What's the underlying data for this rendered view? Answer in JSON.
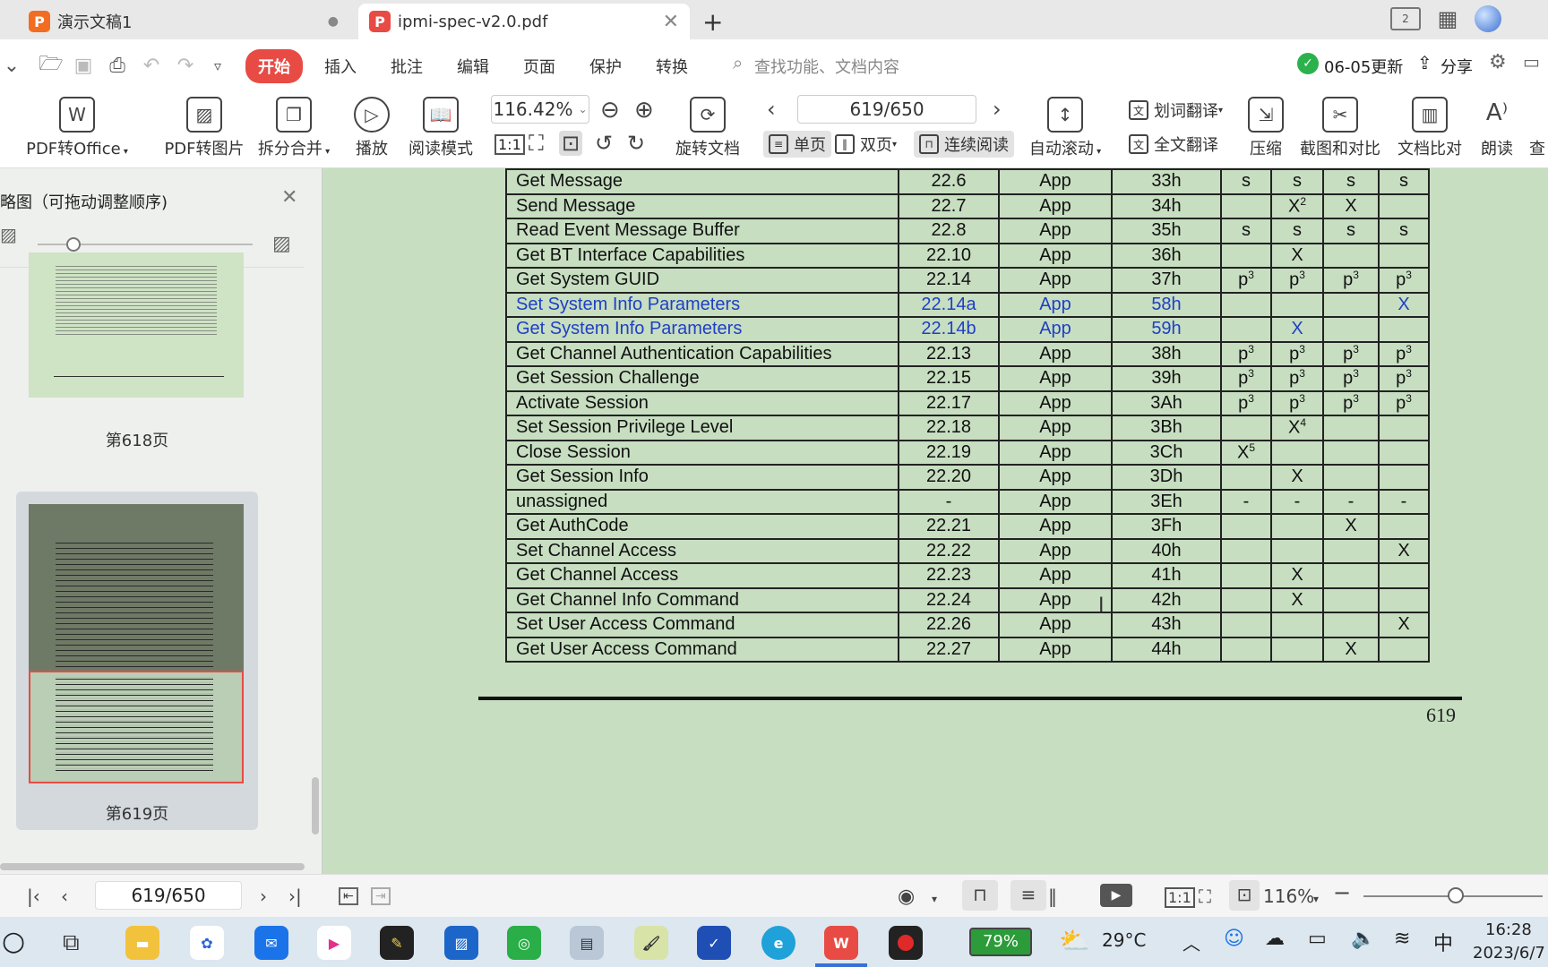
{
  "tabs": [
    {
      "label": "演示文稿1",
      "logo": "P",
      "color": "#f26d21"
    },
    {
      "label": "ipmi-spec-v2.0.pdf",
      "logo": "P",
      "color": "#e84b44"
    }
  ],
  "menu": {
    "items": [
      "开始",
      "插入",
      "批注",
      "编辑",
      "页面",
      "保护",
      "转换"
    ],
    "search_placeholder": "查找功能、文档内容",
    "update": "06-05更新",
    "share": "分享"
  },
  "ribbon": {
    "pdf_to_office": "PDF转Office",
    "pdf_to_image": "PDF转图片",
    "split_merge": "拆分合并",
    "play": "播放",
    "read_mode": "阅读模式",
    "zoom": "116.42%",
    "rotate": "旋转文档",
    "page_field": "619/650",
    "single_page": "单页",
    "double_page": "双页",
    "continuous": "连续阅读",
    "auto_scroll": "自动滚动",
    "word_translate": "划词翻译",
    "full_translate": "全文翻译",
    "compress": "压缩",
    "screenshot_compare": "截图和对比",
    "doc_compare": "文档比对",
    "read_aloud": "朗读",
    "more": "查"
  },
  "sidebar": {
    "title": "略图（可拖动调整顺序)",
    "thumbs": [
      {
        "label": "第618页"
      },
      {
        "label": "第619页"
      }
    ]
  },
  "table": {
    "rows": [
      {
        "name": "Get Message",
        "section": "22.6",
        "netfn": "App",
        "cmd": "33h",
        "c1": "s",
        "c2": "s",
        "c3": "s",
        "c4": "s",
        "link": false
      },
      {
        "name": "Send Message",
        "section": "22.7",
        "netfn": "App",
        "cmd": "34h",
        "c1": "",
        "c2": "X",
        "c2sup": "2",
        "c3": "X",
        "c4": "",
        "link": false
      },
      {
        "name": "Read Event Message Buffer",
        "section": "22.8",
        "netfn": "App",
        "cmd": "35h",
        "c1": "s",
        "c2": "s",
        "c3": "s",
        "c4": "s",
        "link": false
      },
      {
        "name": "Get BT Interface Capabilities",
        "section": "22.10",
        "netfn": "App",
        "cmd": "36h",
        "c1": "",
        "c2": "X",
        "c3": "",
        "c4": "",
        "link": false
      },
      {
        "name": "Get System GUID",
        "section": "22.14",
        "netfn": "App",
        "cmd": "37h",
        "c1": "p",
        "c1sup": "3",
        "c2": "p",
        "c2sup": "3",
        "c3": "p",
        "c3sup": "3",
        "c4": "p",
        "c4sup": "3",
        "link": false
      },
      {
        "name": "Set System Info Parameters",
        "section": "22.14a",
        "netfn": "App",
        "cmd": "58h",
        "c1": "",
        "c2": "",
        "c3": "",
        "c4": "X",
        "link": true
      },
      {
        "name": "Get System Info Parameters",
        "section": "22.14b",
        "netfn": "App",
        "cmd": "59h",
        "c1": "",
        "c2": "X",
        "c3": "",
        "c4": "",
        "link": true
      },
      {
        "name": "Get Channel Authentication Capabilities",
        "section": "22.13",
        "netfn": "App",
        "cmd": "38h",
        "c1": "p",
        "c1sup": "3",
        "c2": "p",
        "c2sup": "3",
        "c3": "p",
        "c3sup": "3",
        "c4": "p",
        "c4sup": "3",
        "link": false
      },
      {
        "name": "Get Session Challenge",
        "section": "22.15",
        "netfn": "App",
        "cmd": "39h",
        "c1": "p",
        "c1sup": "3",
        "c2": "p",
        "c2sup": "3",
        "c3": "p",
        "c3sup": "3",
        "c4": "p",
        "c4sup": "3",
        "link": false
      },
      {
        "name": "Activate Session",
        "section": "22.17",
        "netfn": "App",
        "cmd": "3Ah",
        "c1": "p",
        "c1sup": "3",
        "c2": "p",
        "c2sup": "3",
        "c3": "p",
        "c3sup": "3",
        "c4": "p",
        "c4sup": "3",
        "link": false
      },
      {
        "name": "Set Session Privilege Level",
        "section": "22.18",
        "netfn": "App",
        "cmd": "3Bh",
        "c1": "",
        "c2": "X",
        "c2sup": "4",
        "c3": "",
        "c4": "",
        "link": false
      },
      {
        "name": "Close Session",
        "section": "22.19",
        "netfn": "App",
        "cmd": "3Ch",
        "c1": "X",
        "c1sup": "5",
        "c2": "",
        "c3": "",
        "c4": "",
        "link": false
      },
      {
        "name": "Get Session Info",
        "section": "22.20",
        "netfn": "App",
        "cmd": "3Dh",
        "c1": "",
        "c2": "X",
        "c3": "",
        "c4": "",
        "link": false
      },
      {
        "name": "unassigned",
        "section": "-",
        "netfn": "App",
        "cmd": "3Eh",
        "c1": "-",
        "c2": "-",
        "c3": "-",
        "c4": "-",
        "link": false
      },
      {
        "name": "Get AuthCode",
        "section": "22.21",
        "netfn": "App",
        "cmd": "3Fh",
        "c1": "",
        "c2": "",
        "c3": "X",
        "c4": "",
        "link": false
      },
      {
        "name": "Set Channel Access",
        "section": "22.22",
        "netfn": "App",
        "cmd": "40h",
        "c1": "",
        "c2": "",
        "c3": "",
        "c4": "X",
        "link": false
      },
      {
        "name": "Get Channel Access",
        "section": "22.23",
        "netfn": "App",
        "cmd": "41h",
        "c1": "",
        "c2": "X",
        "c3": "",
        "c4": "",
        "link": false
      },
      {
        "name": "Get Channel Info Command",
        "section": "22.24",
        "netfn": "App",
        "cmd": "42h",
        "c1": "",
        "c2": "X",
        "c3": "",
        "c4": "",
        "link": false
      },
      {
        "name": "Set User Access Command",
        "section": "22.26",
        "netfn": "App",
        "cmd": "43h",
        "c1": "",
        "c2": "",
        "c3": "",
        "c4": "X",
        "link": false
      },
      {
        "name": "Get User Access Command",
        "section": "22.27",
        "netfn": "App",
        "cmd": "44h",
        "c1": "",
        "c2": "",
        "c3": "X",
        "c4": "",
        "link": false
      }
    ],
    "page_number": "619"
  },
  "status": {
    "page": "619/650",
    "zoom": "116%"
  },
  "taskbar": {
    "battery": "79%",
    "temperature": "29°C",
    "ime": "中",
    "time": "16:28",
    "date": "2023/6/7"
  }
}
